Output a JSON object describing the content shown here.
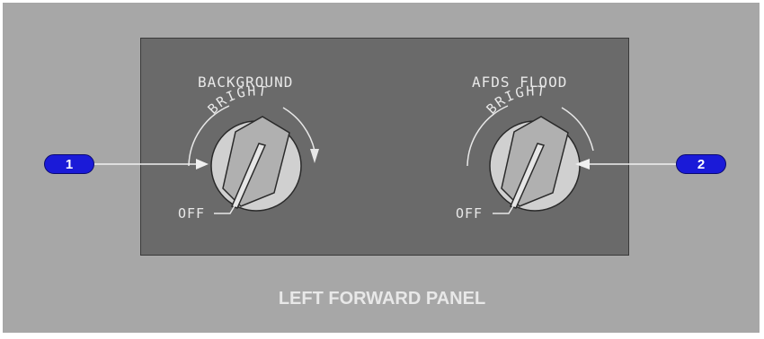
{
  "panel": {
    "title": "LEFT FORWARD PANEL"
  },
  "knobs": [
    {
      "title": "BACKGROUND",
      "arc_label": "BRIGHT",
      "off_label": "OFF"
    },
    {
      "title": "AFDS FLOOD",
      "arc_label": "BRIGHT",
      "off_label": "OFF"
    }
  ],
  "callouts": [
    {
      "number": "1"
    },
    {
      "number": "2"
    }
  ],
  "colors": {
    "callout": "#1a1ad8",
    "panel": "#6a6a6a",
    "background": "#a7a7a7"
  }
}
